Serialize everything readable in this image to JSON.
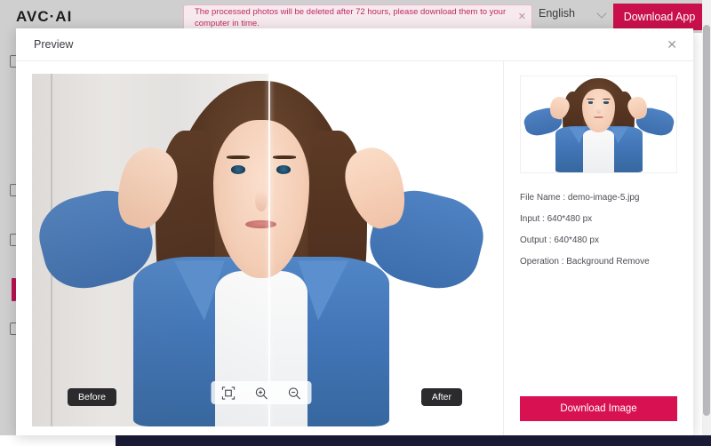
{
  "header": {
    "logo": "AVC·AI",
    "notice": {
      "text": "The processed photos will be deleted after 72 hours, please download them to your computer in time.",
      "close_icon": "close-icon"
    },
    "language": "English",
    "language_chevron_icon": "chevron-down-icon",
    "download_app_label": "Download App"
  },
  "sidebar": {
    "items": [
      {
        "name": "sidebar-item-1",
        "active": false
      },
      {
        "name": "sidebar-item-2",
        "active": false
      },
      {
        "name": "sidebar-item-3",
        "active": false
      },
      {
        "name": "sidebar-item-active",
        "active": true
      },
      {
        "name": "sidebar-item-5",
        "active": false
      }
    ]
  },
  "modal": {
    "title": "Preview",
    "close_icon": "close-icon",
    "viewer": {
      "before_label": "Before",
      "after_label": "After",
      "tools": [
        {
          "label": "Fit to screen",
          "icon": "fit-screen-icon"
        },
        {
          "label": "Zoom in",
          "icon": "zoom-in-icon"
        },
        {
          "label": "Zoom out",
          "icon": "zoom-out-icon"
        }
      ]
    },
    "info": {
      "file_name": "File Name : demo-image-5.jpg",
      "input": "Input : 640*480 px",
      "output": "Output : 640*480 px",
      "operation": "Operation : Background Remove"
    },
    "download_image_label": "Download Image"
  },
  "colors": {
    "brand_pink": "#d81152",
    "header_btn_pink": "#c9104c",
    "notice_text": "#c02a5e",
    "chrome_gray": "#cfcfcf",
    "bottom_bar": "#1b1b38"
  }
}
